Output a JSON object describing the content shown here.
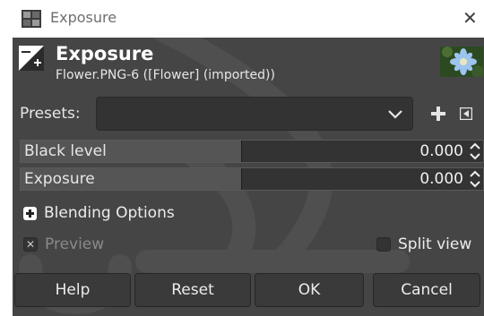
{
  "window": {
    "title": "Exposure",
    "close_icon": "close-icon"
  },
  "header": {
    "title": "Exposure",
    "subtitle": "Flower.PNG-6 ([Flower] (imported))",
    "icon": "exposure-tool-icon",
    "thumbnail": "flower-thumbnail"
  },
  "presets": {
    "label": "Presets:",
    "value": "",
    "add_icon": "plus-icon",
    "menu_icon": "menu-triangle-icon"
  },
  "sliders": [
    {
      "label": "Black level",
      "value": "0.000",
      "fill": 0.5
    },
    {
      "label": "Exposure",
      "value": "0.000",
      "fill": 0.5
    }
  ],
  "blending": {
    "label": "Blending Options",
    "icon": "expand-plus-icon"
  },
  "preview": {
    "label": "Preview",
    "checked": true
  },
  "split_view": {
    "label": "Split view",
    "checked": false
  },
  "buttons": {
    "help": "Help",
    "reset": "Reset",
    "ok": "OK",
    "cancel": "Cancel"
  },
  "colors": {
    "dialog_bg": "#454545",
    "field_bg": "#333333",
    "slider_fill": "#555555"
  }
}
